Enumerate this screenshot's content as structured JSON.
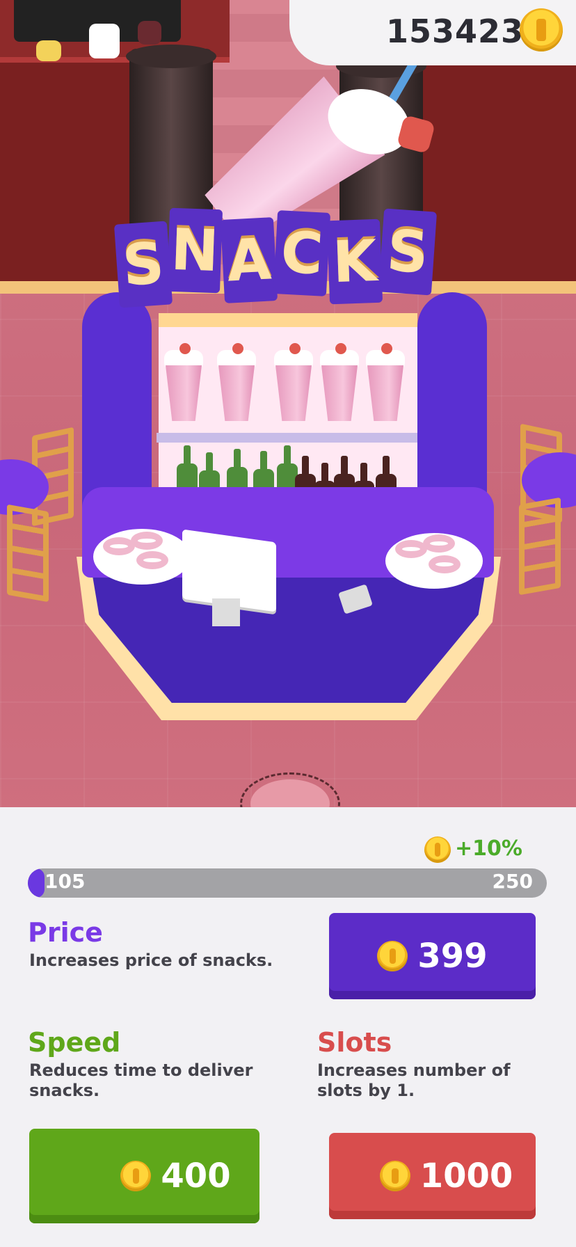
{
  "hud": {
    "coins": "153423",
    "coin_icon": "gold-coin-icon"
  },
  "scene": {
    "sign_letters": [
      "S",
      "N",
      "A",
      "C",
      "K",
      "S"
    ],
    "colors": {
      "booth": "#5a2fd2",
      "sign_text": "#ffe3a8",
      "floor": "#c96a78"
    }
  },
  "panel": {
    "bonus": "+10%",
    "progress": {
      "min_label": "105",
      "max_label": "250",
      "fraction": 0.03
    },
    "price": {
      "title": "Price",
      "description": "Increases price of snacks.",
      "cost": "399",
      "color": "#7a3ae6"
    },
    "speed": {
      "title": "Speed",
      "description_line1": "Reduces time to deliver",
      "description_line2": "snacks.",
      "cost": "400",
      "color": "#5fa71a"
    },
    "slots": {
      "title": "Slots",
      "description_line1": "Increases number of",
      "description_line2": "slots by 1.",
      "cost": "1000",
      "color": "#d84d4d"
    }
  }
}
